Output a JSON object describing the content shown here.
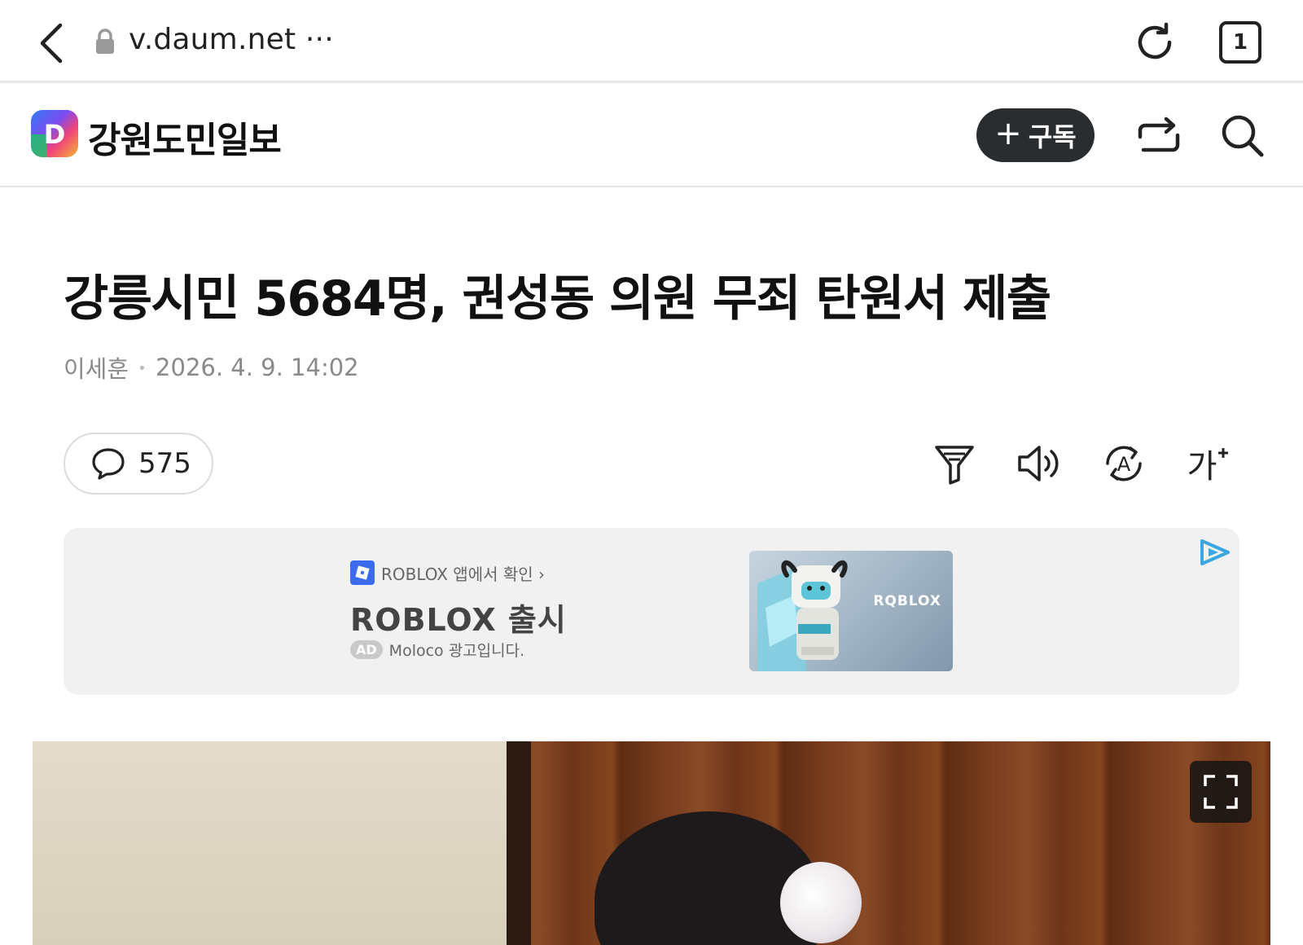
{
  "browser": {
    "url": "v.daum.net ···",
    "tab_count": "1"
  },
  "header": {
    "logo_letter": "D",
    "site_name": "강원도민일보",
    "subscribe_label": "구독",
    "subscribe_plus": "+"
  },
  "article": {
    "title": "강릉시민 5684명, 권성동 의원 무죄 탄원서 제출",
    "author": "이세훈",
    "datetime": "2026. 4. 9. 14:02",
    "comment_count": "575",
    "font_tool_label": "가"
  },
  "ad": {
    "source_text": "ROBLOX 앱에서 확인 ›",
    "headline": "ROBLOX 출시",
    "badge": "AD",
    "disclosure": "Moloco 광고입니다.",
    "image_brand": "RQBLOX"
  },
  "colors": {
    "subscribe_bg": "#2a2d30",
    "ad_bg": "#f1f1f1",
    "adchoices": "#3aa7e0",
    "roblox_blue": "#3b6cf0"
  }
}
